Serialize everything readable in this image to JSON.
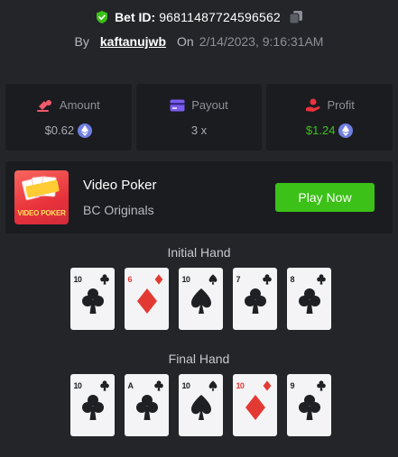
{
  "header": {
    "bet_id_label": "Bet ID:",
    "bet_id_value": "96811487724596562",
    "by_label": "By",
    "username": "kaftanujwb",
    "on_label": "On",
    "date": "2/14/2023, 9:16:31AM"
  },
  "stats": {
    "amount": {
      "label": "Amount",
      "value": "$0.62",
      "currency_icon": "eth-icon"
    },
    "payout": {
      "label": "Payout",
      "value": "3 x"
    },
    "profit": {
      "label": "Profit",
      "value": "$1.24",
      "currency_icon": "eth-icon"
    }
  },
  "game": {
    "thumb_text": "VIDEO POKER",
    "name": "Video Poker",
    "provider": "BC Originals",
    "play_label": "Play Now"
  },
  "initial_hand": {
    "title": "Initial Hand",
    "cards": [
      {
        "rank": "10",
        "suit": "club"
      },
      {
        "rank": "6",
        "suit": "diamond"
      },
      {
        "rank": "10",
        "suit": "spade"
      },
      {
        "rank": "7",
        "suit": "club"
      },
      {
        "rank": "8",
        "suit": "club"
      }
    ]
  },
  "final_hand": {
    "title": "Final Hand",
    "cards": [
      {
        "rank": "10",
        "suit": "club"
      },
      {
        "rank": "A",
        "suit": "club"
      },
      {
        "rank": "10",
        "suit": "spade"
      },
      {
        "rank": "10",
        "suit": "diamond"
      },
      {
        "rank": "9",
        "suit": "club"
      }
    ]
  },
  "colors": {
    "background": "#232529",
    "panel": "#1b1c20",
    "accent_green": "#3bc117",
    "card_red": "#e23a33",
    "card_black": "#1e2024"
  }
}
